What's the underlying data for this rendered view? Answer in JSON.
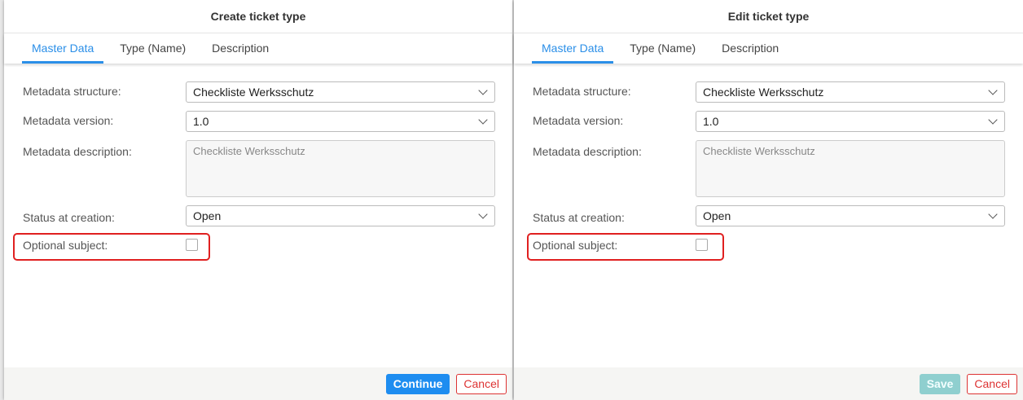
{
  "create": {
    "title": "Create ticket type",
    "tabs": [
      "Master Data",
      "Type (Name)",
      "Description"
    ],
    "labels": {
      "structure": "Metadata structure:",
      "version": "Metadata version:",
      "description": "Metadata description:",
      "status": "Status at creation:",
      "optional": "Optional subject:"
    },
    "values": {
      "structure": "Checkliste Werksschutz",
      "version": "1.0",
      "description": "Checkliste Werksschutz",
      "status": "Open",
      "optional_checked": false
    },
    "buttons": {
      "primary": "Continue",
      "cancel": "Cancel"
    }
  },
  "edit": {
    "title": "Edit ticket type",
    "tabs": [
      "Master Data",
      "Type (Name)",
      "Description"
    ],
    "labels": {
      "structure": "Metadata structure:",
      "version": "Metadata version:",
      "description": "Metadata description:",
      "status": "Status at creation:",
      "optional": "Optional subject:"
    },
    "values": {
      "structure": "Checkliste Werksschutz",
      "version": "1.0",
      "description": "Checkliste Werksschutz",
      "status": "Open",
      "optional_checked": false
    },
    "buttons": {
      "primary": "Save",
      "cancel": "Cancel"
    }
  }
}
